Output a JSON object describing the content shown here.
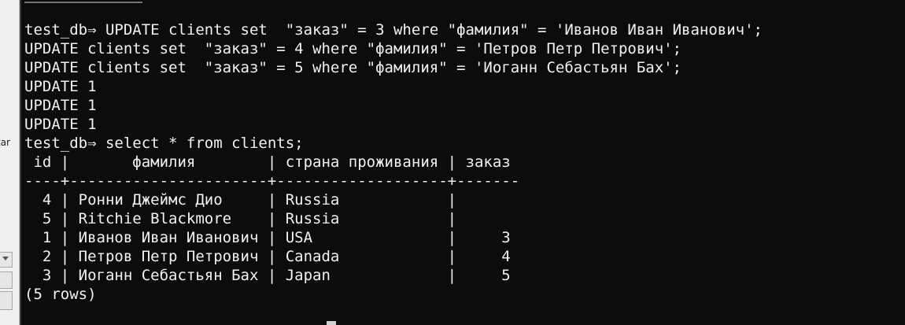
{
  "sidebar": {
    "partial_label": "tar"
  },
  "terminal": {
    "lines": [
      "test_db⇒ UPDATE clients set  \"заказ\" = 3 where \"фамилия\" = 'Иванов Иван Иванович';",
      "UPDATE clients set  \"заказ\" = 4 where \"фамилия\" = 'Петров Петр Петрович';",
      "UPDATE clients set  \"заказ\" = 5 where \"фамилия\" = 'Иоганн Себастьян Бах';",
      "UPDATE 1",
      "UPDATE 1",
      "UPDATE 1",
      "test_db⇒ select * from clients;",
      " id |       фамилия        | страна проживания | заказ",
      "----+----------------------+-------------------+-------",
      "  4 | Ронни Джеймс Дио     | Russia            |",
      "  5 | Ritchie Blackmore    | Russia            |",
      "  1 | Иванов Иван Иванович | USA               |     3",
      "  2 | Петров Петр Петрович | Canada            |     4",
      "  3 | Иоганн Себастьян Бах | Japan             |     5",
      "(5 rows)"
    ]
  },
  "colors": {
    "terminal_bg": "#0c0c0c",
    "terminal_fg": "#f2f2f2",
    "sidebar_bg": "#f0f0f0"
  }
}
